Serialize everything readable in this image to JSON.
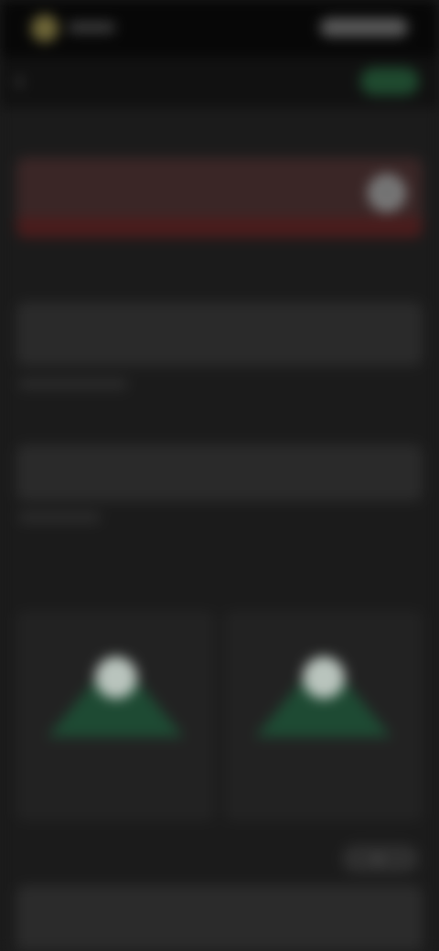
{
  "status_bar": {
    "time": "",
    "brand": ""
  },
  "header": {
    "back_label": "",
    "save_label": ""
  },
  "sections": {
    "name_title": "",
    "name_value": "",
    "description_title": "",
    "description_value": "",
    "tags_title": "",
    "tags_value": "",
    "images_title": "",
    "card_one_label": "",
    "card_two_label": "",
    "more_title": "",
    "more_action": ""
  },
  "icons": {
    "back": "chevron-left-icon",
    "clear": "close-icon",
    "avatar": "person-icon",
    "add": "plus-icon"
  },
  "colors": {
    "background": "#1b1b1b",
    "accent": "#7fd39a",
    "error": "#4a1c1c"
  }
}
